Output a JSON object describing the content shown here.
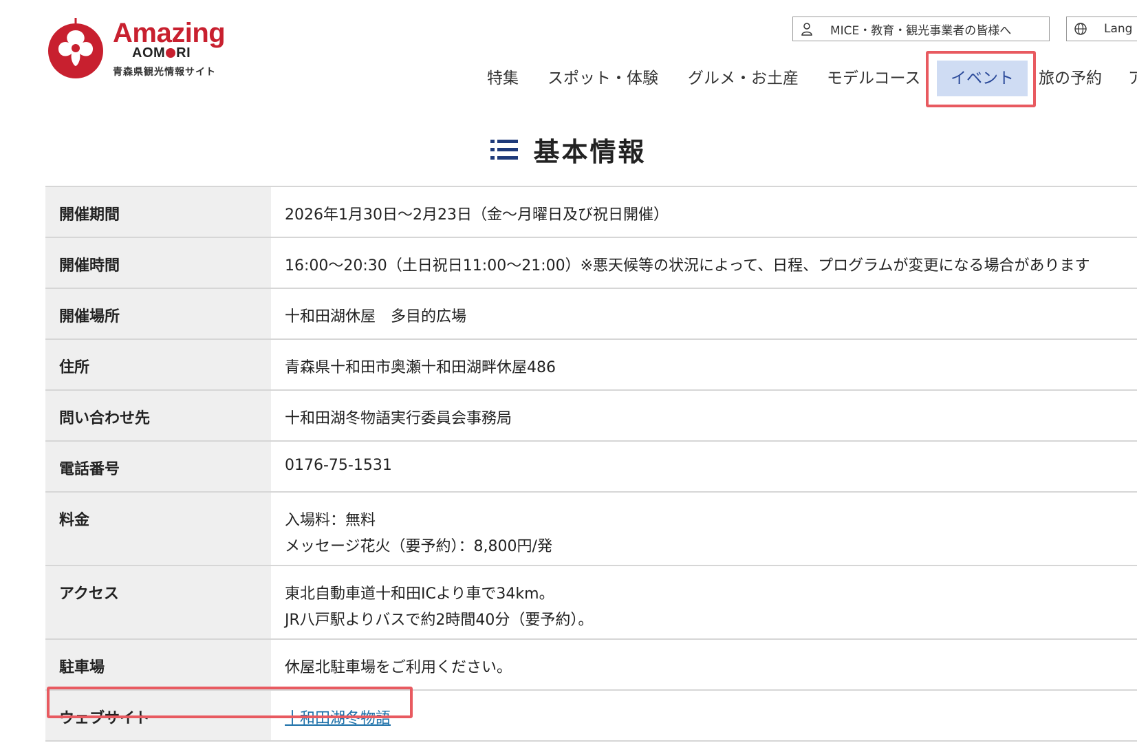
{
  "brand": {
    "amazing": "Amazing",
    "aomori_pre": "AOM",
    "aomori_post": "RI",
    "subtitle": "青森県観光情報サイト",
    "red": "#c8202f"
  },
  "utility": {
    "mice": {
      "label": "MICE・教育・観光事業者の皆様へ",
      "icon": "person-icon"
    },
    "lang": {
      "label": "Lang",
      "icon": "globe-icon"
    }
  },
  "nav": {
    "items": [
      {
        "label": "特集"
      },
      {
        "label": "スポット・体験"
      },
      {
        "label": "グルメ・お土産"
      },
      {
        "label": "モデルコース"
      },
      {
        "label": "イベント",
        "active": true
      },
      {
        "label": "旅の予約"
      },
      {
        "label": "ア"
      }
    ],
    "active_bg": "#cfdcf3",
    "highlight": "#e85a60"
  },
  "section": {
    "title": "基本情報",
    "icon": "list-icon"
  },
  "info": {
    "rows": [
      {
        "label": "開催期間",
        "value": [
          "2026年1月30日〜2月23日（金〜月曜日及び祝日開催）"
        ]
      },
      {
        "label": "開催時間",
        "value": [
          "16:00〜20:30（土日祝日11:00〜21:00）※悪天候等の状況によって、日程、プログラムが変更になる場合があります"
        ]
      },
      {
        "label": "開催場所",
        "value": [
          "十和田湖休屋　多目的広場"
        ]
      },
      {
        "label": "住所",
        "value": [
          "青森県十和田市奥瀬十和田湖畔休屋486"
        ]
      },
      {
        "label": "問い合わせ先",
        "value": [
          "十和田湖冬物語実行委員会事務局"
        ]
      },
      {
        "label": "電話番号",
        "value": [
          "0176-75-1531"
        ]
      },
      {
        "label": "料金",
        "value": [
          "入場料：無料",
          "メッセージ花火（要予約）：8,800円/発"
        ]
      },
      {
        "label": "アクセス",
        "value": [
          "東北自動車道十和田ICより車で34km。",
          "JR八戸駅よりバスで約2時間40分（要予約）。"
        ]
      },
      {
        "label": "駐車場",
        "value": [
          "休屋北駐車場をご利用ください。"
        ]
      },
      {
        "label": "ウェブサイト",
        "link": "十和田湖冬物語"
      }
    ]
  }
}
